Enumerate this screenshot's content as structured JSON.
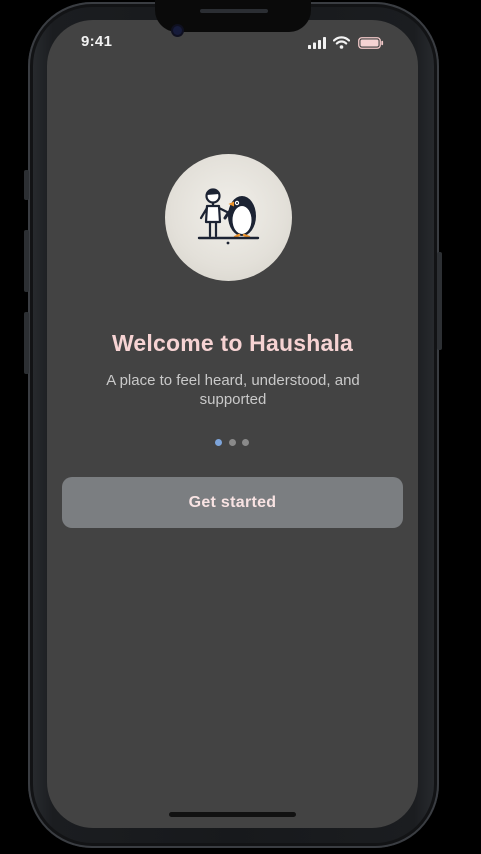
{
  "status_bar": {
    "time": "9:41",
    "icons": [
      "signal-icon",
      "wifi-icon",
      "battery-icon"
    ]
  },
  "onboarding": {
    "logo": "child-and-penguin-logo",
    "title": "Welcome to Haushala",
    "subtitle": "A place to feel heard, understood, and supported",
    "pager": {
      "current_page": 1,
      "total_pages": 3
    },
    "cta_label": "Get started"
  },
  "colors": {
    "background": "#434343",
    "title": "#f6d3d3",
    "subtitle": "#c9c9c9",
    "button_bg": "#7b7e81",
    "button_text": "#f8e3e3",
    "pager_active": "#7da4da",
    "pager_inactive": "#8a8a8a"
  }
}
